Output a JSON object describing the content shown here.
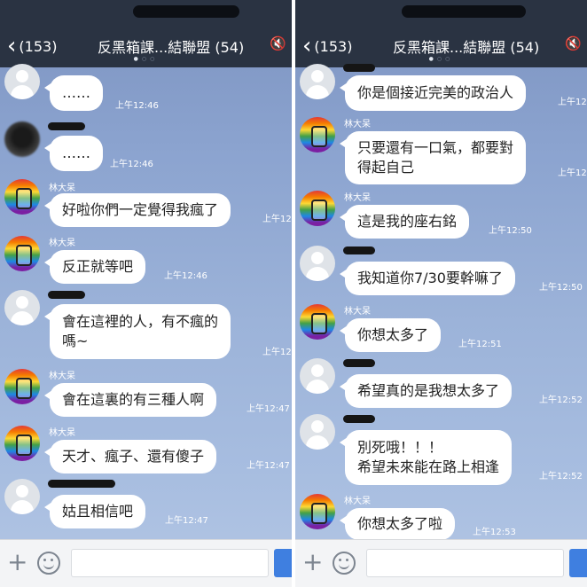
{
  "header": {
    "back_count": "(153)",
    "title": "反黑箱課...結聯盟 (54)"
  },
  "panels": [
    {
      "messages": [
        {
          "avatar": "default-avatar",
          "name": "",
          "text": "……",
          "time": "上午12:46"
        },
        {
          "avatar": "redacted-avatar",
          "name": "",
          "text": "……",
          "time": "上午12:46"
        },
        {
          "avatar": "rainbow-avatar",
          "name": "林大呆",
          "text": "好啦你們一定覺得我瘋了",
          "time": "上午12:"
        },
        {
          "avatar": "rainbow-avatar",
          "name": "林大呆",
          "text": "反正就等吧",
          "time": "上午12:46"
        },
        {
          "avatar": "default-avatar",
          "name": "",
          "text": "會在這裡的人，有不瘋的\n嗎~",
          "time": "上午12:"
        },
        {
          "avatar": "rainbow-avatar",
          "name": "林大呆",
          "text": "會在這裏的有三種人啊",
          "time": "上午12:47"
        },
        {
          "avatar": "rainbow-avatar",
          "name": "林大呆",
          "text": "天才、瘋子、還有傻子",
          "time": "上午12:47"
        },
        {
          "avatar": "default-avatar",
          "name": "",
          "text": "姑且相信吧",
          "time": "上午12:47"
        }
      ]
    },
    {
      "messages": [
        {
          "avatar": "default-avatar",
          "name": "",
          "text": "你是個接近完美的政治人",
          "time": "上午12:"
        },
        {
          "avatar": "rainbow-avatar",
          "name": "林大呆",
          "text": "只要還有一口氣，都要對\n得起自己",
          "time": "上午12:"
        },
        {
          "avatar": "rainbow-avatar",
          "name": "林大呆",
          "text": "這是我的座右銘",
          "time": "上午12:50"
        },
        {
          "avatar": "default-avatar",
          "name": "",
          "text": "我知道你7/30要幹嘛了",
          "time": "上午12:50"
        },
        {
          "avatar": "rainbow-avatar",
          "name": "林大呆",
          "text": "你想太多了",
          "time": "上午12:51"
        },
        {
          "avatar": "default-avatar",
          "name": "",
          "text": "希望真的是我想太多了",
          "time": "上午12:52"
        },
        {
          "avatar": "default-avatar",
          "name": "",
          "text": "別死哦！！！\n希望未來能在路上相逢",
          "time": "上午12:52"
        },
        {
          "avatar": "rainbow-avatar",
          "name": "林大呆",
          "text": "你想太多了啦",
          "time": "上午12:53"
        }
      ]
    }
  ],
  "icons": {
    "back": "chevron-left-icon",
    "mute": "speaker-muted-icon",
    "add": "plus-icon",
    "emoji": "smiley-icon",
    "send": "send-icon"
  },
  "colors": {
    "header_bg": "#2a3342",
    "chat_bg": "#8ba3cf",
    "bubble_bg": "#ffffff",
    "send_button": "#3f7fe0"
  }
}
